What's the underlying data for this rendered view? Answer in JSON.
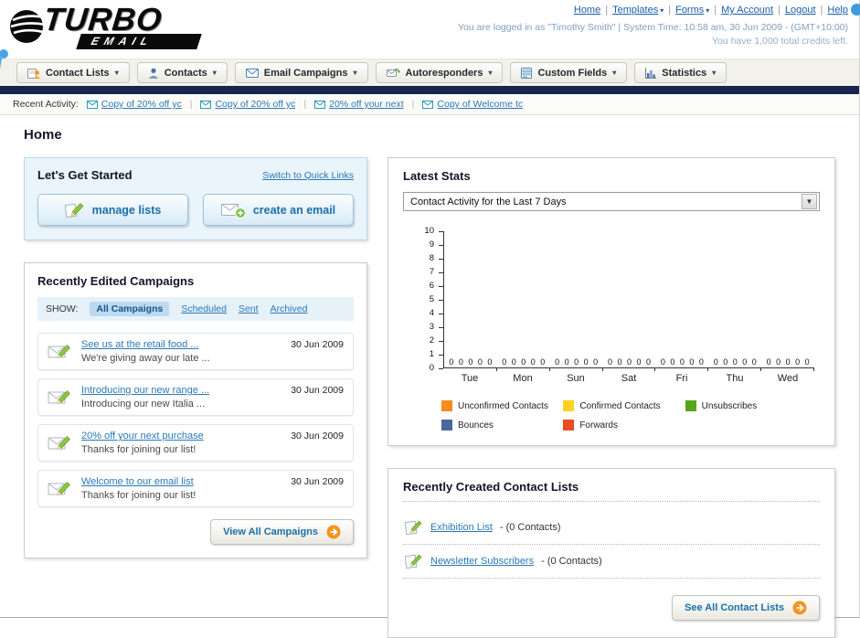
{
  "colors": {
    "navy_bar": "#18254e",
    "link_blue": "#2a79b8",
    "accent_orange": "#f7941d",
    "panel_blue_bg": "#e9f4fb"
  },
  "header": {
    "logo_title": "TURBO",
    "logo_subtitle": "EMAIL",
    "nav_links": [
      "Home",
      "Templates",
      "Forms",
      "My Account",
      "Logout",
      "Help"
    ],
    "login_info": "You are logged in as \"Timothy Smith\" | System Time: 10:58 am, 30 Jun 2009 - (GMT+10:00)",
    "credits_info": "You have 1,000 total credits left."
  },
  "main_nav": {
    "tabs": [
      {
        "label": "Contact Lists"
      },
      {
        "label": "Contacts"
      },
      {
        "label": "Email Campaigns"
      },
      {
        "label": "Autoresponders"
      },
      {
        "label": "Custom Fields"
      },
      {
        "label": "Statistics"
      }
    ]
  },
  "recent_activity": {
    "label": "Recent Activity:",
    "items": [
      "Copy of 20% off yc",
      "Copy of 20% off yc",
      "20% off your next",
      "Copy of Welcome tc"
    ]
  },
  "page_title": "Home",
  "get_started": {
    "title": "Let's Get Started",
    "switch_link": "Switch to Quick Links",
    "buttons": [
      {
        "label": "manage lists"
      },
      {
        "label": "create an email"
      }
    ]
  },
  "campaigns": {
    "title": "Recently Edited Campaigns",
    "show_label": "SHOW:",
    "filters": [
      "All Campaigns",
      "Scheduled",
      "Sent",
      "Archived"
    ],
    "active_filter": "All Campaigns",
    "items": [
      {
        "title": "See us at the retail food ...",
        "subtitle": "We're giving away our late ...",
        "date": "30 Jun 2009"
      },
      {
        "title": "Introducing our new range ...",
        "subtitle": "Introducing our new Italia ...",
        "date": "30 Jun 2009"
      },
      {
        "title": "20% off your next purchase",
        "subtitle": "Thanks for joining our list!",
        "date": "30 Jun 2009"
      },
      {
        "title": "Welcome to our email list",
        "subtitle": "Thanks for joining our list!",
        "date": "30 Jun 2009"
      }
    ],
    "view_all_label": "View All Campaigns"
  },
  "stats": {
    "title": "Latest Stats",
    "dropdown_value": "Contact Activity for the Last 7 Days",
    "legend": [
      {
        "label": "Unconfirmed Contacts",
        "color": "#f68b1f"
      },
      {
        "label": "Confirmed Contacts",
        "color": "#ffd21e"
      },
      {
        "label": "Unsubscribes",
        "color": "#58a618"
      },
      {
        "label": "Bounces",
        "color": "#4a68a0"
      },
      {
        "label": "Forwards",
        "color": "#e84c22"
      }
    ]
  },
  "chart_data": {
    "type": "bar",
    "title": "Contact Activity for the Last 7 Days",
    "categories": [
      "Tue",
      "Mon",
      "Sun",
      "Sat",
      "Fri",
      "Thu",
      "Wed"
    ],
    "series": [
      {
        "name": "Unconfirmed Contacts",
        "values": [
          0,
          0,
          0,
          0,
          0,
          0,
          0
        ]
      },
      {
        "name": "Confirmed Contacts",
        "values": [
          0,
          0,
          0,
          0,
          0,
          0,
          0
        ]
      },
      {
        "name": "Unsubscribes",
        "values": [
          0,
          0,
          0,
          0,
          0,
          0,
          0
        ]
      },
      {
        "name": "Bounces",
        "values": [
          0,
          0,
          0,
          0,
          0,
          0,
          0
        ]
      },
      {
        "name": "Forwards",
        "values": [
          0,
          0,
          0,
          0,
          0,
          0,
          0
        ]
      }
    ],
    "xlabel": "",
    "ylabel": "",
    "ylim": [
      0,
      10
    ],
    "yticks": [
      0,
      1,
      2,
      3,
      4,
      5,
      6,
      7,
      8,
      9,
      10
    ],
    "grid": false,
    "legend_position": "bottom"
  },
  "contact_lists": {
    "title": "Recently Created Contact Lists",
    "items": [
      {
        "name": "Exhibition List",
        "suffix": " - (0 Contacts)"
      },
      {
        "name": "Newsletter Subscribers",
        "suffix": " - (0 Contacts)"
      }
    ],
    "see_all_label": "See All Contact Lists"
  }
}
